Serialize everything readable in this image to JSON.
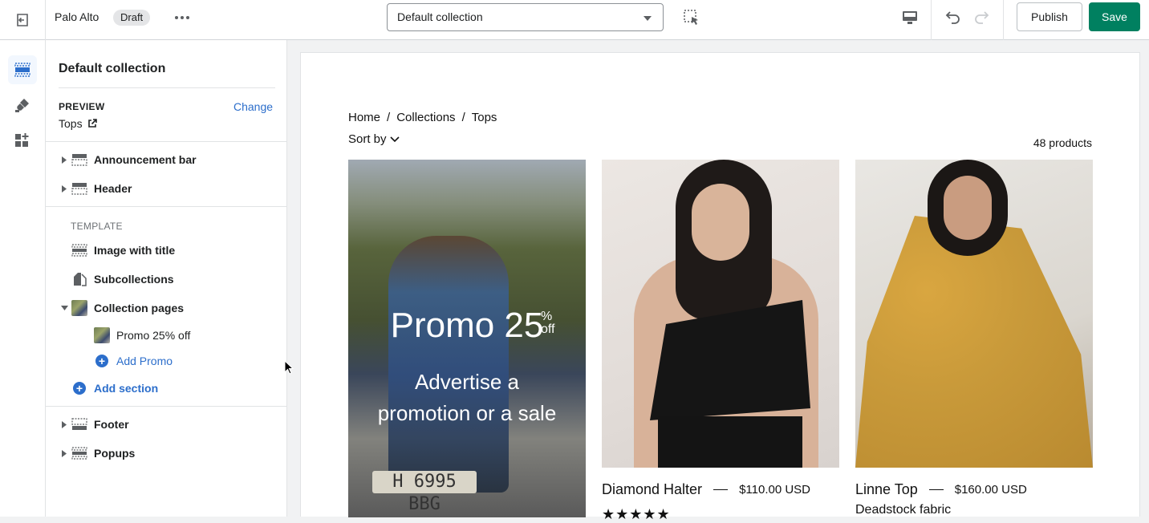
{
  "topbar": {
    "theme_name": "Palo Alto",
    "status_badge": "Draft",
    "page_selector_value": "Default collection",
    "publish_label": "Publish",
    "save_label": "Save"
  },
  "rail": {
    "items": [
      {
        "icon": "sections-icon",
        "active": true
      },
      {
        "icon": "theme-settings-brush-icon",
        "active": false
      },
      {
        "icon": "app-embeds-icon",
        "active": false
      }
    ]
  },
  "sidebar": {
    "title": "Default collection",
    "preview_label": "PREVIEW",
    "change_label": "Change",
    "preview_value": "Tops",
    "header_sections": [
      "Announcement bar",
      "Header"
    ],
    "template_label": "TEMPLATE",
    "template_sections": [
      "Image with title",
      "Subcollections",
      "Collection pages"
    ],
    "collection_pages_children": [
      "Promo 25% off"
    ],
    "add_promo_label": "Add Promo",
    "add_section_label": "Add section",
    "footer_sections": [
      "Footer",
      "Popups"
    ]
  },
  "preview": {
    "breadcrumb": [
      "Home",
      "/",
      "Collections",
      "/",
      "Tops"
    ],
    "sort_label": "Sort by",
    "product_count": "48 products",
    "promo": {
      "title": "Promo 25",
      "percent": "%",
      "off": "off",
      "subtitle_line1": "Advertise a",
      "subtitle_line2": "promotion or a sale",
      "plate": "H 6995 BBG"
    },
    "products": [
      {
        "name": "Diamond Halter",
        "price": "$110.00 USD",
        "stars": "★★★★★"
      },
      {
        "name": "Linne Top",
        "price": "$160.00 USD",
        "desc": "Deadstock fabric"
      }
    ]
  }
}
